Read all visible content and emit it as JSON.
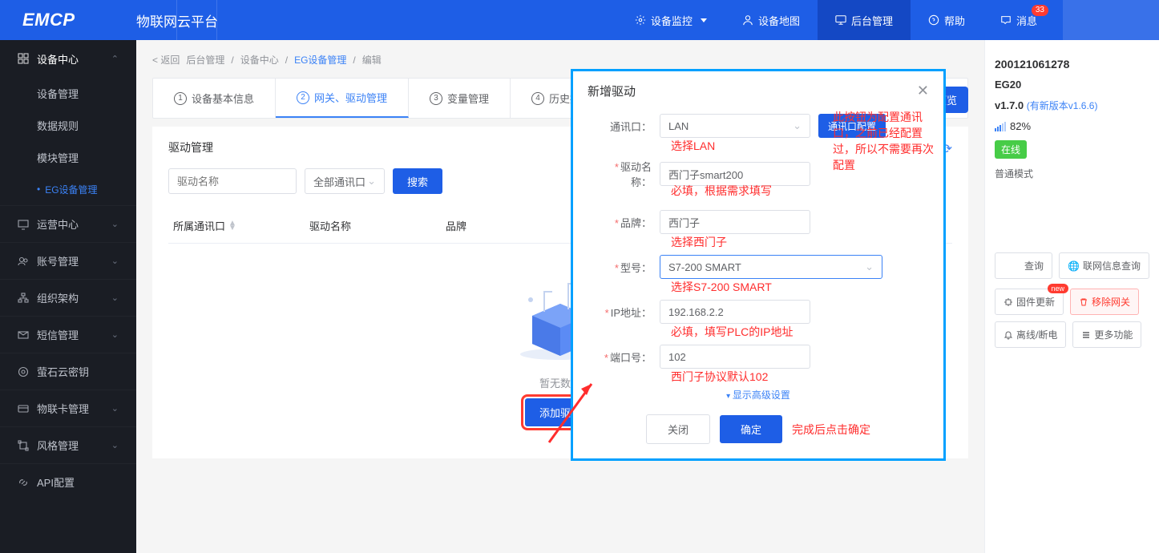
{
  "brand": {
    "logo": "EMCP",
    "title": "物联网云平台"
  },
  "topnav": {
    "monitor": "设备监控",
    "map": "设备地图",
    "admin": "后台管理",
    "help": "帮助",
    "msg": "消息",
    "msg_badge": "33"
  },
  "sidebar": {
    "device_center": "设备中心",
    "items": {
      "device_mgmt": "设备管理",
      "data_rule": "数据规则",
      "module_mgmt": "模块管理",
      "eg_mgmt": "EG设备管理"
    },
    "ops_center": "运营中心",
    "account_mgmt": "账号管理",
    "org": "组织架构",
    "sms": "短信管理",
    "ys": "萤石云密钥",
    "iot_card": "物联卡管理",
    "risk": "风格管理",
    "api": "API配置"
  },
  "breadcrumb": {
    "back": "< 返回",
    "admin": "后台管理",
    "dc": "设备中心",
    "eg": "EG设备管理",
    "edit": "编辑"
  },
  "preview_btn": "预览",
  "tabs": {
    "t1": "设备基本信息",
    "t2": "网关、驱动管理",
    "t3": "变量管理",
    "t4": "历史报表管"
  },
  "panel": {
    "title": "驱动管理",
    "search_placeholder": "驱动名称",
    "port_sel": "全部通讯口",
    "search_btn": "搜索",
    "th_port": "所属通讯口",
    "th_name": "驱动名称",
    "th_brand": "品牌",
    "empty_text": "暂无数据",
    "add_btn": "添加驱动"
  },
  "modal": {
    "title": "新增驱动",
    "fields": {
      "port_label": "通讯口：",
      "port_value": "LAN",
      "port_btn": "通讯口配置",
      "name_label": "驱动名称：",
      "name_value": "西门子smart200",
      "brand_label": "品牌：",
      "brand_value": "西门子",
      "model_label": "型号：",
      "model_value": "S7-200 SMART",
      "ip_label": "IP地址：",
      "ip_value": "192.168.2.2",
      "portnum_label": "端口号：",
      "portnum_value": "102"
    },
    "show_adv": "显示高级设置",
    "cancel": "关闭",
    "ok": "确定",
    "annotations": {
      "port": "选择LAN",
      "port_btn": "此按钮为配置通讯口，之前已经配置过，所以不需要再次配置",
      "name": "必填，根据需求填写",
      "brand": "选择西门子",
      "model": "选择S7-200 SMART",
      "ip": "必填，填写PLC的IP地址",
      "portnum": "西门子协议默认102",
      "ok": "完成后点击确定"
    }
  },
  "device": {
    "sn": "200121061278",
    "model": "EG20",
    "version": "v1.7.0",
    "version_link": "(有新版本v1.6.6)",
    "signal": "82%",
    "status": "在线",
    "mode": "普通模式",
    "buttons": {
      "query": "查询",
      "netinfo": "联网信息查询",
      "fw": "固件更新",
      "fw_new": "new",
      "remove": "移除网关",
      "offline": "离线/断电",
      "more": "更多功能"
    }
  }
}
